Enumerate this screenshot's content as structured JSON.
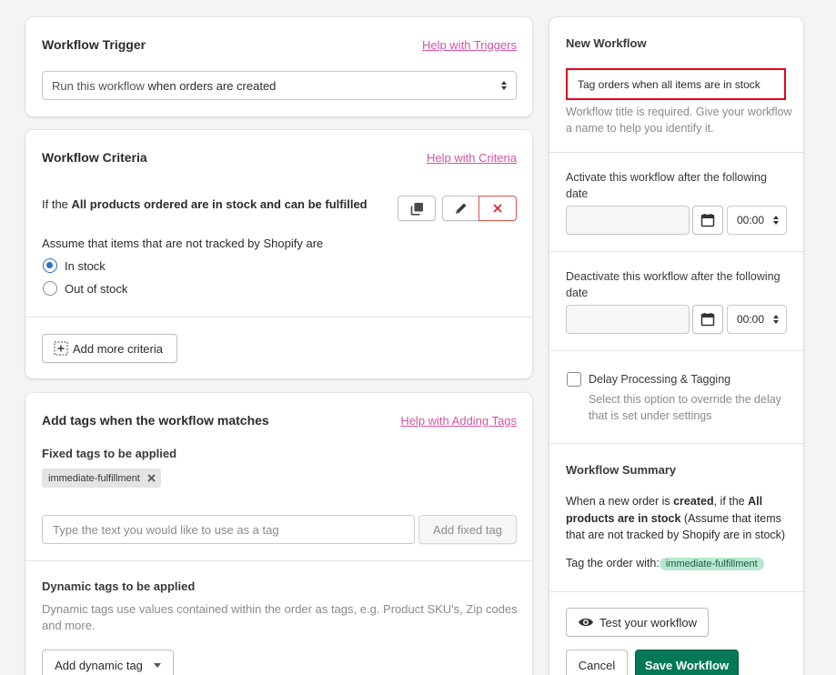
{
  "trigger": {
    "title": "Workflow Trigger",
    "help": "Help with Triggers",
    "select_prefix": "Run this workflow",
    "select_value": "when orders are created"
  },
  "criteria": {
    "title": "Workflow Criteria",
    "help": "Help with Criteria",
    "rule_prefix": "If the",
    "rule_bold": "All products ordered are in stock and can be fulfilled",
    "assume_label": "Assume that items that are not tracked by Shopify are",
    "options": [
      "In stock",
      "Out of stock"
    ],
    "selected_option": "In stock",
    "add_button": "Add more criteria"
  },
  "tags": {
    "title": "Add tags when the workflow matches",
    "help": "Help with Adding Tags",
    "fixed_label": "Fixed tags to be applied",
    "fixed_tags": [
      "immediate-fulfillment"
    ],
    "input_placeholder": "Type the text you would like to use as a tag",
    "add_fixed_button": "Add fixed tag",
    "dynamic_label": "Dynamic tags to be applied",
    "dynamic_desc": "Dynamic tags use values contained within the order as tags, e.g. Product SKU's, Zip codes and more.",
    "add_dynamic_button": "Add dynamic tag"
  },
  "sidebar": {
    "title": "New Workflow",
    "name_value": "Tag orders when all items are in stock",
    "name_help": "Workflow title is required. Give your workflow a name to help you identify it.",
    "activate_label": "Activate this workflow after the following date",
    "activate_time": "00:00",
    "deactivate_label": "Deactivate this workflow after the following date",
    "deactivate_time": "00:00",
    "delay_label": "Delay Processing & Tagging",
    "delay_help": "Select this option to override the delay that is set under settings",
    "summary_title": "Workflow Summary",
    "summary": {
      "p1": "When a new order is ",
      "b1": "created",
      "p2": ", if the ",
      "b2": "All products are in stock",
      "p3": " (Assume that items that are not tracked by Shopify are in stock)"
    },
    "tag_with_label": "Tag the order with:",
    "tag_with_value": "immediate-fulfillment",
    "test_button": "Test your workflow",
    "cancel_button": "Cancel",
    "save_button": "Save Workflow"
  },
  "colors": {
    "link": "#d254a6",
    "primary": "#047857",
    "highlight_border": "#e3001b",
    "radio_selected": "#2c6ecb",
    "summary_chip": "#b7e7cf"
  }
}
